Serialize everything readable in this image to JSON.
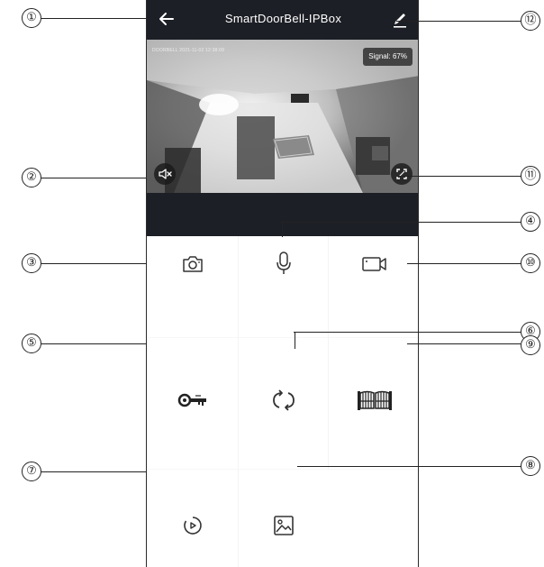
{
  "header": {
    "title": "SmartDoorBell-IPBox",
    "back_icon": "arrow-left-icon",
    "edit_icon": "pencil-icon"
  },
  "video": {
    "osd_text": "DOORBELL 2021-11-02 12:38:09",
    "signal_label": "Signal: 67%",
    "mute_icon": "speaker-muted-icon",
    "fullscreen_icon": "fullscreen-icon"
  },
  "controls": [
    {
      "id": "snapshot",
      "icon": "camera-icon"
    },
    {
      "id": "talk",
      "icon": "microphone-icon"
    },
    {
      "id": "record",
      "icon": "video-record-icon"
    },
    {
      "id": "unlock",
      "icon": "key-icon"
    },
    {
      "id": "switch",
      "icon": "rotate-icon"
    },
    {
      "id": "gate",
      "icon": "gate-icon"
    },
    {
      "id": "playback",
      "icon": "playback-icon"
    },
    {
      "id": "album",
      "icon": "image-icon"
    }
  ],
  "callouts": [
    "①",
    "②",
    "③",
    "④",
    "⑤",
    "⑥",
    "⑦",
    "⑧",
    "⑨",
    "⑩",
    "⑪",
    "⑫"
  ],
  "colors": {
    "bar": "#1d1f26",
    "icon": "#333333",
    "background": "#ffffff"
  }
}
